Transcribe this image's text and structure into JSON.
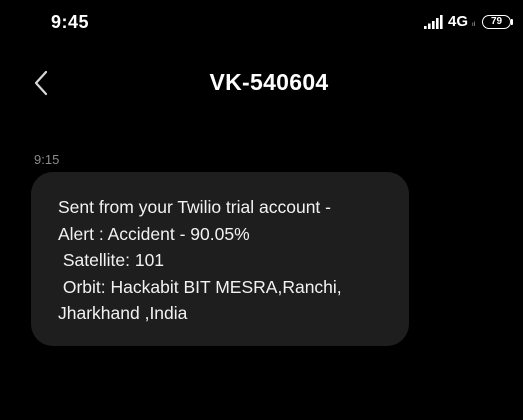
{
  "status_bar": {
    "time": "9:45",
    "network": "4G",
    "network_sub": "ıl",
    "battery": "79"
  },
  "header": {
    "title": "VK-540604"
  },
  "message": {
    "time": "9:15",
    "lines": [
      "Sent from your Twilio trial account -",
      "Alert : Accident - 90.05%",
      " Satellite: 101",
      " Orbit: Hackabit BIT MESRA,Ranchi,",
      "Jharkhand ,India"
    ]
  },
  "icons": {
    "back": "chevron-left-icon",
    "signal": "signal-bars-icon",
    "battery": "battery-icon"
  },
  "colors": {
    "background": "#000000",
    "bubble": "#1e1e1e",
    "text": "#f2f2f2",
    "muted": "#8a8a8a"
  }
}
